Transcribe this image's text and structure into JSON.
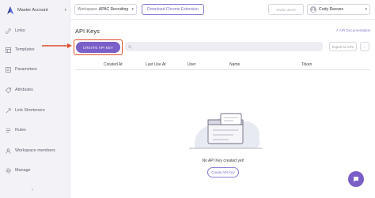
{
  "sidebar": {
    "account_label": "Master Account",
    "collapse_symbol": "‹",
    "items": [
      {
        "label": "Links",
        "icon": "link-icon"
      },
      {
        "label": "Templates",
        "icon": "template-icon"
      },
      {
        "label": "Parameters",
        "icon": "parameters-icon"
      },
      {
        "label": "Attributes",
        "icon": "attributes-icon"
      },
      {
        "label": "Link Shorteners",
        "icon": "link-shortener-icon"
      },
      {
        "label": "Rules",
        "icon": "rules-icon"
      },
      {
        "label": "Workspace members",
        "icon": "members-icon"
      },
      {
        "label": "Manage",
        "icon": "gear-icon"
      }
    ]
  },
  "header": {
    "workspace_prefix": "Workspace",
    "workspace_value": "APAC Recruiting",
    "extension_button": "Download Chrome Extension",
    "faded_button": "Invite Users",
    "user_name": "Cody Reeves"
  },
  "main": {
    "title": "API Keys",
    "doc_link": "API Documentation",
    "create_button": "CREATE API KEY",
    "export_button": "Export to CSV",
    "more_button": "⋮",
    "columns": [
      "Created At",
      "Last Use At",
      "User",
      "Name",
      "Token"
    ],
    "empty_text": "No API Key created yet!",
    "empty_button": "Create API Key"
  },
  "colors": {
    "accent": "#7a5fc8",
    "highlight": "#e0502a",
    "sidebar_bg": "#f3f3f7"
  }
}
